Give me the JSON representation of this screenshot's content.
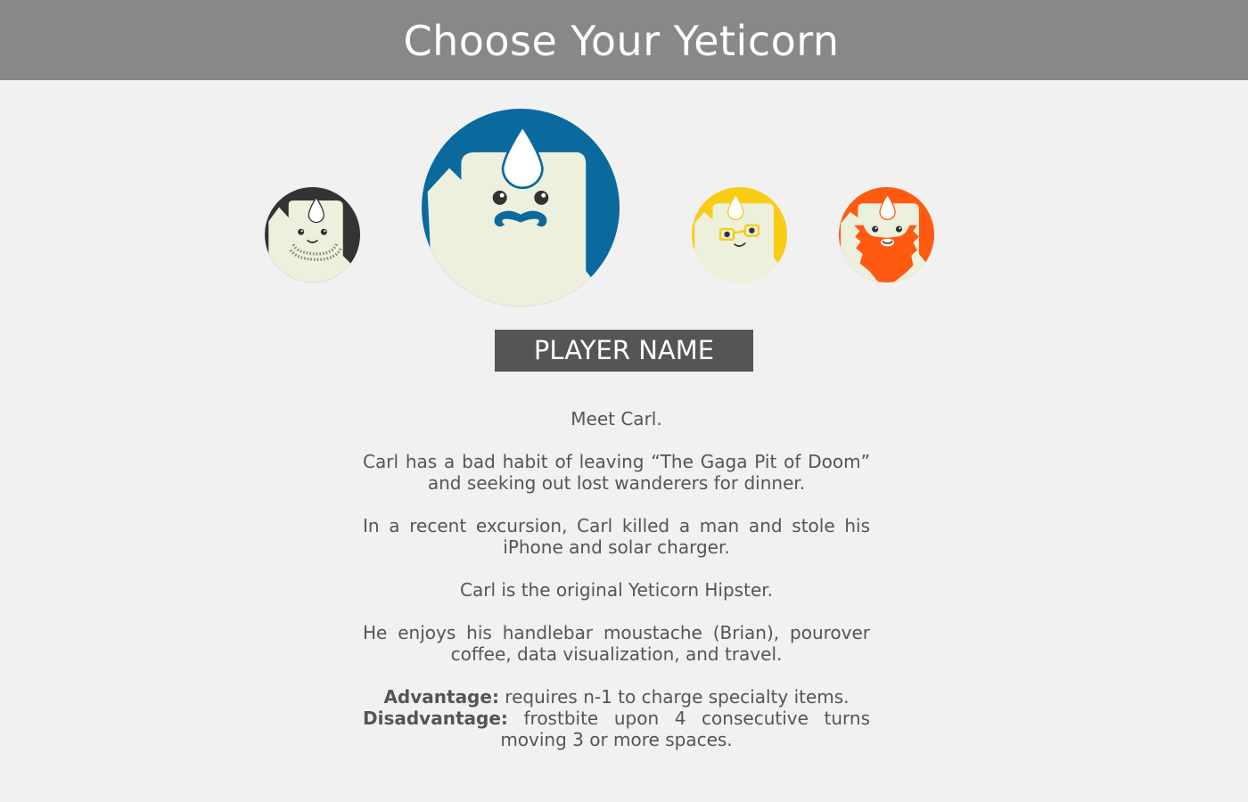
{
  "header": {
    "title": "Choose Your Yeticorn"
  },
  "characters": [
    {
      "accent": "#333333",
      "selected": false,
      "feature": "beard-stubble"
    },
    {
      "accent": "#0a6a9e",
      "selected": true,
      "feature": "handlebar-moustache"
    },
    {
      "accent": "#f9cc14",
      "selected": false,
      "feature": "glasses"
    },
    {
      "accent": "#ff5a12",
      "selected": false,
      "feature": "red-beard"
    }
  ],
  "player_name": {
    "placeholder": "PLAYER NAME"
  },
  "bio": {
    "intro": "Meet Carl.",
    "p1": "Carl has a bad habit of leaving “The Gaga Pit of Doom” and seeking out lost wanderers for dinner.",
    "p2": "In a recent excursion, Carl killed a man and stole his iPhone and solar charger.",
    "p3": "Carl is the original Yeticorn Hipster.",
    "p4": "He enjoys his handlebar moustache (Brian), pourover coffee, data visualization, and travel.",
    "advantage_label": "Advantage:",
    "advantage_text": " requires n-1 to charge specialty items.",
    "disadvantage_label": "Disadvantage:",
    "disadvantage_text": " frostbite upon 4 consecutive turns moving 3 or more spaces."
  },
  "colors": {
    "header_bg": "#888888",
    "page_bg": "#f1f1f1",
    "text": "#555555",
    "yeti_body": "#ecf0dc",
    "horn": "#ffffff"
  }
}
